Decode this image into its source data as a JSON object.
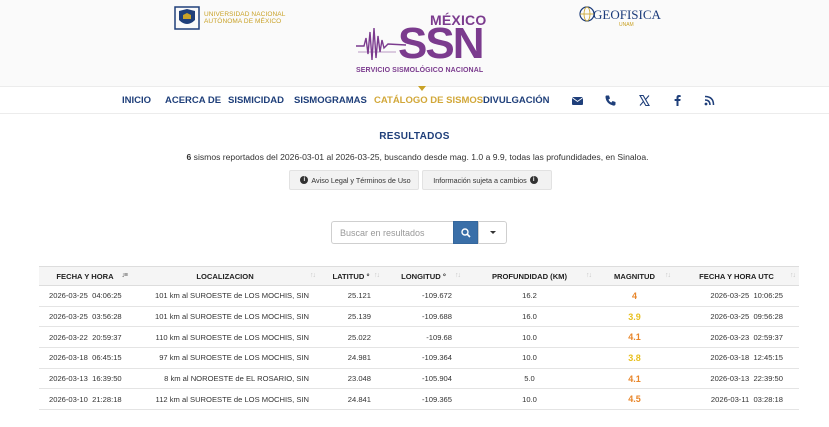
{
  "header": {
    "unam_text_line1": "UNIVERSIDAD NACIONAL",
    "unam_text_line2": "AUTÓNOMA DE MÉXICO",
    "ssn_country": "MÉXICO",
    "ssn_acronym": "SSN",
    "ssn_name": "SERVICIO SISMOLÓGICO NACIONAL",
    "geofisica_text": "GEOFISICA",
    "geofisica_sub": "UNAM"
  },
  "nav": {
    "items": [
      {
        "label": "INICIO",
        "active": false
      },
      {
        "label": "ACERCA DE",
        "active": false
      },
      {
        "label": "SISMICIDAD",
        "active": false
      },
      {
        "label": "SISMOGRAMAS",
        "active": false
      },
      {
        "label": "CATÁLOGO DE SISMOS",
        "active": true
      },
      {
        "label": "DIVULGACIÓN",
        "active": false
      }
    ],
    "icons": [
      "envelope-icon",
      "phone-icon",
      "x-twitter-icon",
      "facebook-icon",
      "rss-icon"
    ]
  },
  "results": {
    "title": "RESULTADOS",
    "count": "6",
    "summary": " sismos reportados del 2026-03-01 al 2026-03-25, buscando desde mag. 1.0 a 9.9, todas las profundidades, en Sinaloa.",
    "legal_label": "Aviso Legal y Términos de Uso",
    "changes_label": "Información sujeta a cambios"
  },
  "search": {
    "placeholder": "Buscar en resultados"
  },
  "colors": {
    "accent": "#1f3f7a",
    "active_nav": "#d2a83a",
    "brand_purple": "#7b3b8e",
    "search_btn": "#3a6fa8",
    "mag_orange": "#e8862a",
    "mag_yellow": "#e8c020"
  },
  "table": {
    "columns": [
      "FECHA Y HORA",
      "LOCALIZACION",
      "LATITUD °",
      "LONGITUD °",
      "PROFUNDIDAD (KM)",
      "MAGNITUD",
      "FECHA Y HORA UTC"
    ],
    "rows": [
      {
        "date": "2026-03-25",
        "time": "04:06:25",
        "loc": "101 km al SUROESTE de LOS MOCHIS, SIN",
        "lat": "25.121",
        "lon": "-109.672",
        "depth": "16.2",
        "mag": "4",
        "mag_color": "#e8862a",
        "utc_date": "2026-03-25",
        "utc_time": "10:06:25"
      },
      {
        "date": "2026-03-25",
        "time": "03:56:28",
        "loc": "101 km al SUROESTE de LOS MOCHIS, SIN",
        "lat": "25.139",
        "lon": "-109.688",
        "depth": "16.0",
        "mag": "3.9",
        "mag_color": "#e8c020",
        "utc_date": "2026-03-25",
        "utc_time": "09:56:28"
      },
      {
        "date": "2026-03-22",
        "time": "20:59:37",
        "loc": "110 km al SUROESTE de LOS MOCHIS, SIN",
        "lat": "25.022",
        "lon": "-109.68",
        "depth": "10.0",
        "mag": "4.1",
        "mag_color": "#e8862a",
        "utc_date": "2026-03-23",
        "utc_time": "02:59:37"
      },
      {
        "date": "2026-03-18",
        "time": "06:45:15",
        "loc": "97 km al SUROESTE de LOS MOCHIS, SIN",
        "lat": "24.981",
        "lon": "-109.364",
        "depth": "10.0",
        "mag": "3.8",
        "mag_color": "#e8c020",
        "utc_date": "2026-03-18",
        "utc_time": "12:45:15"
      },
      {
        "date": "2026-03-13",
        "time": "16:39:50",
        "loc": "8 km al NOROESTE de EL ROSARIO, SIN",
        "lat": "23.048",
        "lon": "-105.904",
        "depth": "5.0",
        "mag": "4.1",
        "mag_color": "#e8862a",
        "utc_date": "2026-03-13",
        "utc_time": "22:39:50"
      },
      {
        "date": "2026-03-10",
        "time": "21:28:18",
        "loc": "112 km al SUROESTE de LOS MOCHIS, SIN",
        "lat": "24.841",
        "lon": "-109.365",
        "depth": "10.0",
        "mag": "4.5",
        "mag_color": "#e8862a",
        "utc_date": "2026-03-11",
        "utc_time": "03:28:18"
      }
    ]
  }
}
